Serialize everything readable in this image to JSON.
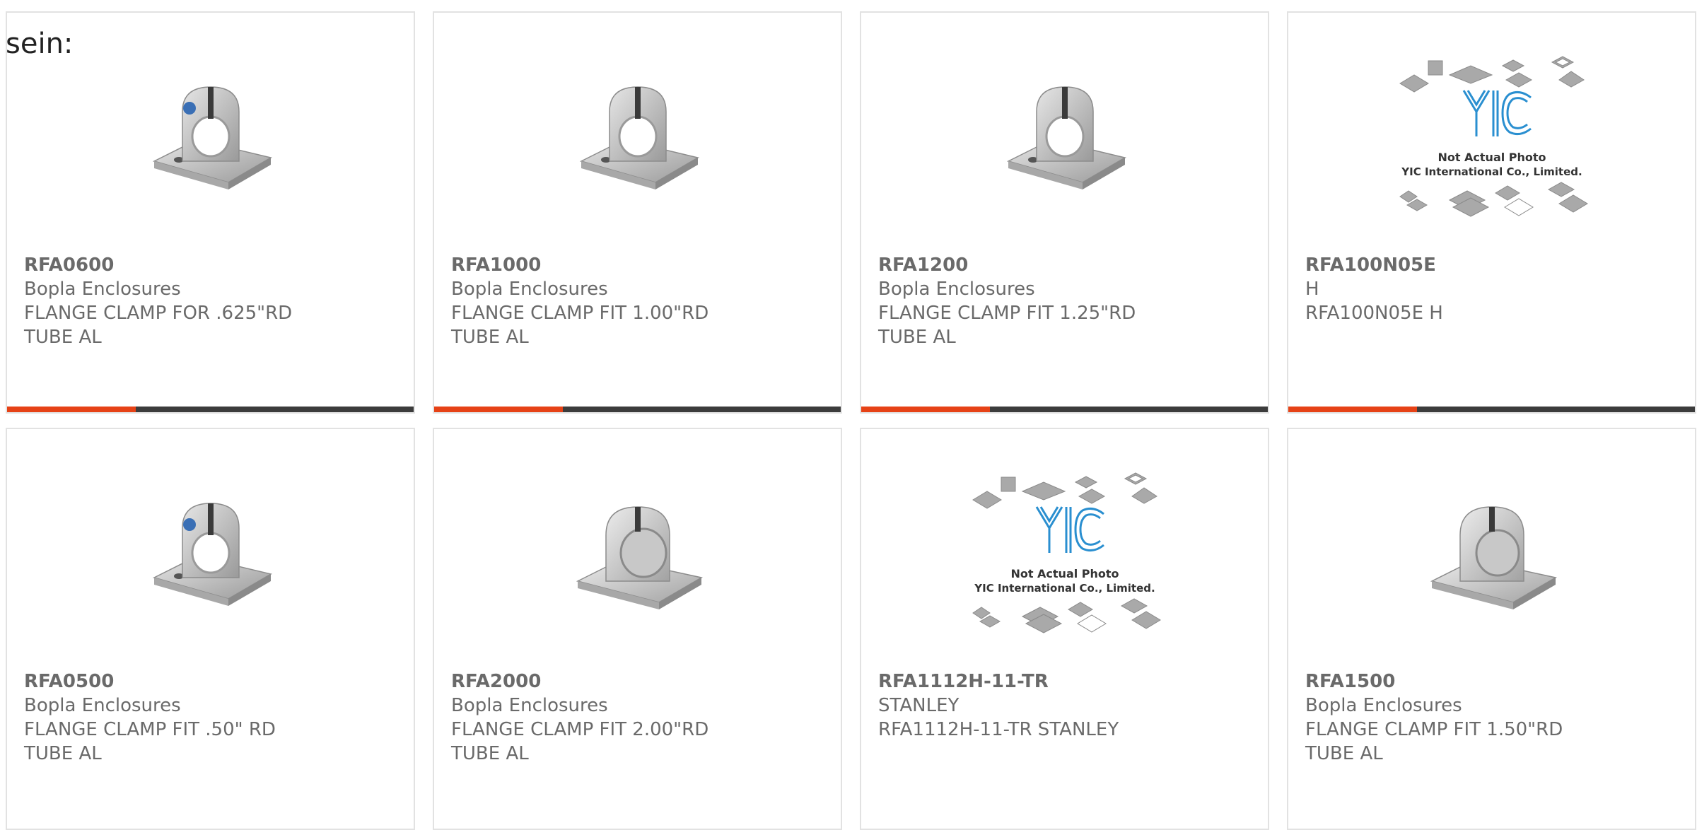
{
  "page_label": "sein:",
  "colors": {
    "accent": "#e64216",
    "bar_dark": "#3c3c3c",
    "card_border": "#e2e2e2",
    "text": "#6a6a6a",
    "yic_logo": "#2a8fd0"
  },
  "products": [
    {
      "part": "RFA0600",
      "manufacturer": "Bopla Enclosures",
      "desc_line1": "FLANGE CLAMP FOR .625\"RD",
      "desc_line2": "TUBE AL",
      "image": "flange-clamp-photo"
    },
    {
      "part": "RFA1000",
      "manufacturer": "Bopla Enclosures",
      "desc_line1": "FLANGE CLAMP FIT 1.00\"RD",
      "desc_line2": "TUBE AL",
      "image": "flange-clamp-photo"
    },
    {
      "part": "RFA1200",
      "manufacturer": "Bopla Enclosures",
      "desc_line1": "FLANGE CLAMP FIT 1.25\"RD",
      "desc_line2": "TUBE AL",
      "image": "flange-clamp-photo"
    },
    {
      "part": "RFA100N05E",
      "manufacturer": "H",
      "desc_line1": "RFA100N05E H",
      "desc_line2": "",
      "image": "not-actual-photo-placeholder",
      "placeholder_line1": "Not Actual Photo",
      "placeholder_line2": "YIC International Co., Limited."
    },
    {
      "part": "RFA0500",
      "manufacturer": "Bopla Enclosures",
      "desc_line1": "FLANGE CLAMP FIT .50\" RD",
      "desc_line2": "TUBE AL",
      "image": "flange-clamp-photo"
    },
    {
      "part": "RFA2000",
      "manufacturer": "Bopla Enclosures",
      "desc_line1": "FLANGE CLAMP FIT 2.00\"RD",
      "desc_line2": "TUBE AL",
      "image": "flange-clamp-photo"
    },
    {
      "part": "RFA1112H-11-TR",
      "manufacturer": "STANLEY",
      "desc_line1": "RFA1112H-11-TR STANLEY",
      "desc_line2": "",
      "image": "not-actual-photo-placeholder",
      "placeholder_line1": "Not Actual Photo",
      "placeholder_line2": "YIC International Co., Limited."
    },
    {
      "part": "RFA1500",
      "manufacturer": "Bopla Enclosures",
      "desc_line1": "FLANGE CLAMP FIT 1.50\"RD",
      "desc_line2": "TUBE AL",
      "image": "flange-clamp-photo"
    }
  ]
}
